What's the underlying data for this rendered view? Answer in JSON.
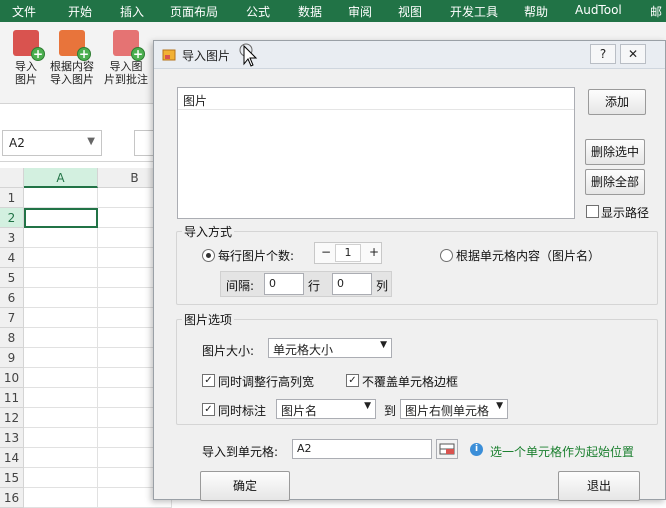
{
  "menu": [
    "文件",
    "开始",
    "插入",
    "页面布局",
    "公式",
    "数据",
    "审阅",
    "视图",
    "开发工具",
    "帮助",
    "AudTool",
    "邮"
  ],
  "ribbon": {
    "btn1": [
      "导入",
      "图片"
    ],
    "btn2": [
      "根据内容",
      "导入图片"
    ],
    "btn3": [
      "导入图",
      "片到批注"
    ]
  },
  "namebox": "A2",
  "grid": {
    "cols": [
      "A",
      "B"
    ],
    "rows": [
      "1",
      "2",
      "3",
      "4",
      "5",
      "6",
      "7",
      "8",
      "9",
      "10",
      "11",
      "12",
      "13",
      "14",
      "15",
      "16"
    ]
  },
  "dialog": {
    "title": "导入图片",
    "help": "?",
    "close": "✕",
    "list_header": "图片",
    "add": "添加",
    "delete_selected": "删除选中",
    "delete_all": "删除全部",
    "show_path": "显示路径",
    "import_mode": {
      "title": "导入方式",
      "per_row_label": "每行图片个数:",
      "minus": "−",
      "per_row_value": "1",
      "plus": "+",
      "by_content": "根据单元格内容（图片名）",
      "spacing_label": "间隔:",
      "spacing_rows": "0",
      "rows_unit": "行",
      "spacing_cols": "0",
      "cols_unit": "列"
    },
    "options": {
      "title": "图片选项",
      "size_label": "图片大小:",
      "size_value": "单元格大小",
      "adjust_rowcol": "同时调整行高列宽",
      "no_cover_border": "不覆盖单元格边框",
      "annotate": "同时标注",
      "annotate_value": "图片名",
      "to": "到",
      "target_value": "图片右侧单元格"
    },
    "import_to_label": "导入到单元格:",
    "import_to_value": "A2",
    "hint": "选一个单元格作为起始位置",
    "ok": "确定",
    "exit": "退出"
  }
}
